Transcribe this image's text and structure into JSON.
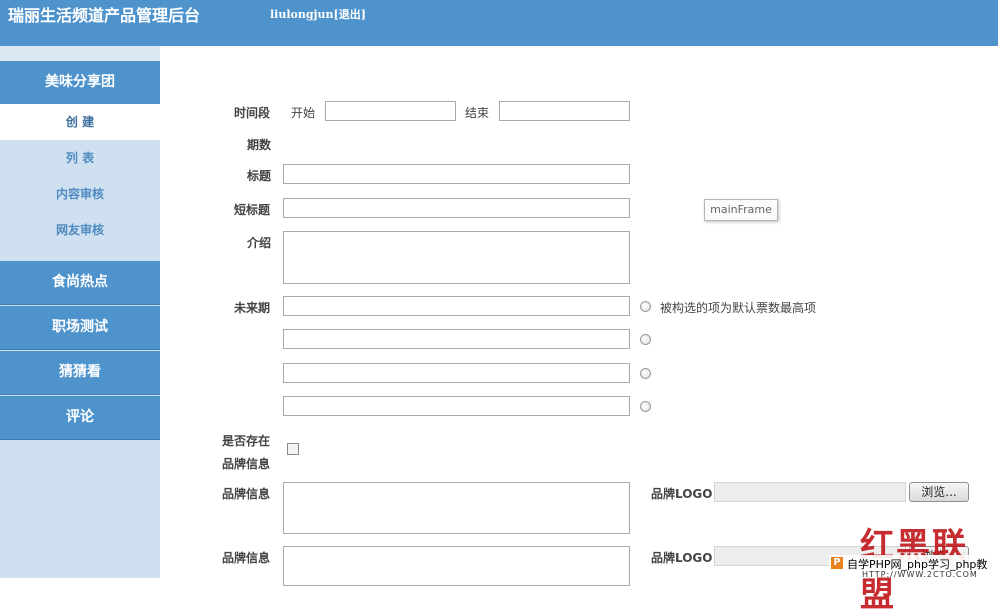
{
  "header": {
    "title": "瑞丽生活频道产品管理后台",
    "username": "liulongjun",
    "logout": "[退出]"
  },
  "sidebar": {
    "groups": [
      {
        "label": "美味分享团"
      },
      {
        "label": "食尚热点"
      },
      {
        "label": "职场测试"
      },
      {
        "label": "猜猜看"
      },
      {
        "label": "评论"
      }
    ],
    "sub_items": [
      {
        "label": "创 建",
        "active": true
      },
      {
        "label": "列 表"
      },
      {
        "label": "内容审核"
      },
      {
        "label": "网友审核"
      }
    ]
  },
  "form": {
    "time_label": "时间段",
    "start_label": "开始",
    "end_label": "结束",
    "start_value": "",
    "end_value": "",
    "period_label": "期数",
    "title_label": "标题",
    "title_value": "",
    "short_title_label": "短标题",
    "short_title_value": "",
    "intro_label": "介绍",
    "intro_value": "",
    "future_label": "未来期",
    "default_option_hint": "被构选的项为默认票数最高项",
    "options": [
      "",
      "",
      "",
      ""
    ],
    "brand_exists_label_line1": "是否存在",
    "brand_exists_label_line2": "品牌信息",
    "brand_exists_checked": false,
    "brand_info_label": "品牌信息",
    "brand_logo_label": "品牌LOGO",
    "browse_label": "浏览..."
  },
  "tooltip": {
    "text": "mainFrame"
  },
  "watermark": {
    "big": "红黑联盟",
    "site": "自学PHP网_php学习_php教",
    "url": "HTTP://WWW.2CTO.COM"
  },
  "colors": {
    "header_bg": "#4f93cd",
    "sidebar_bg": "#cfe1f1",
    "sub_item_text": "#4f8ac0",
    "watermark_red": "#c0161a"
  }
}
